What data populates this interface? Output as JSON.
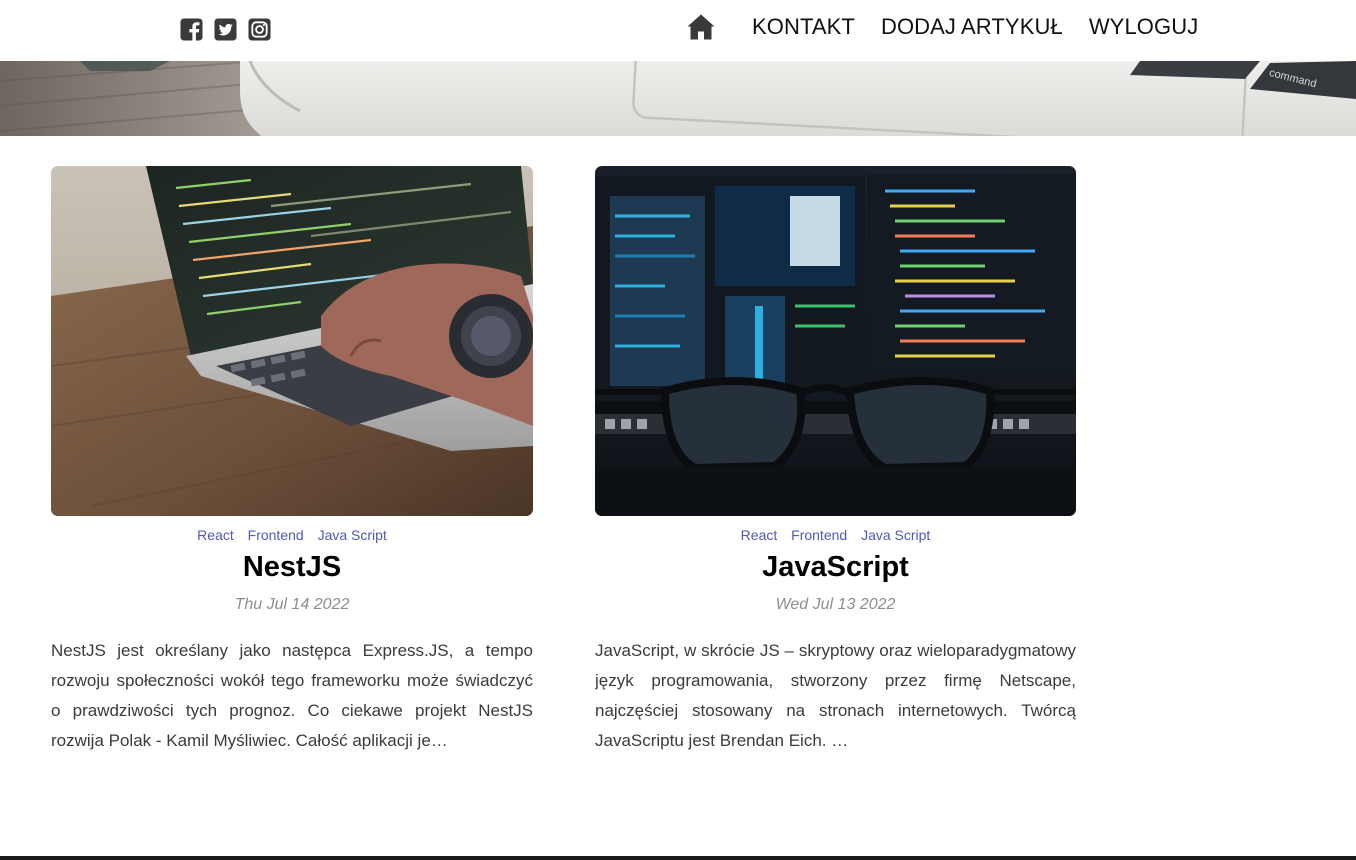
{
  "social": {
    "icons": [
      "facebook-icon",
      "twitter-icon",
      "instagram-icon"
    ]
  },
  "nav": {
    "home_icon": "home-icon",
    "items": [
      "KONTAKT",
      "DODAJ ARTYKUŁ",
      "WYLOGUJ"
    ]
  },
  "colors": {
    "tag": "#5258b8",
    "date": "#8d8d8d",
    "text": "#3b3b3b"
  },
  "articles": [
    {
      "tags": [
        "React",
        "Frontend",
        "Java Script"
      ],
      "title": "NestJS",
      "date": "Thu Jul 14 2022",
      "excerpt": "NestJS jest określany jako następca Express.JS, a tempo rozwoju społeczności wokół tego frameworku może świadczyć o prawdziwości tych prognoz. Co ciekawe projekt NestJS rozwija Polak - Kamil Myśliwiec. Całość aplikacji je…",
      "image": "laptop-hand-photo"
    },
    {
      "tags": [
        "React",
        "Frontend",
        "Java Script"
      ],
      "title": "JavaScript",
      "date": "Wed Jul 13 2022",
      "excerpt": "JavaScript, w skrócie JS – skryptowy oraz wieloparadygmatowy język programowania, stworzony przez firmę Netscape, najczęściej stosowany na stronach internetowych. Twórcą JavaScriptu jest Brendan Eich. …",
      "image": "monitors-glasses-photo"
    }
  ]
}
